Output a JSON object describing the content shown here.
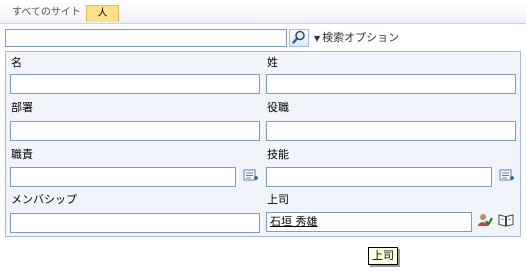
{
  "tabs": [
    {
      "label": "すべてのサイト",
      "active": false
    },
    {
      "label": "人",
      "active": true
    }
  ],
  "search": {
    "value": "",
    "go_icon": "magnifier-icon",
    "options_label": "検索オプション"
  },
  "form": {
    "first_name": {
      "label": "名",
      "value": ""
    },
    "last_name": {
      "label": "姓",
      "value": ""
    },
    "department": {
      "label": "部署",
      "value": ""
    },
    "title": {
      "label": "役職",
      "value": ""
    },
    "responsibilities": {
      "label": "職責",
      "value": "",
      "picker_icon": "browse-list-icon"
    },
    "skills": {
      "label": "技能",
      "value": "",
      "picker_icon": "browse-list-icon"
    },
    "memberships": {
      "label": "メンバシップ",
      "value": ""
    },
    "manager": {
      "label": "上司",
      "value": "石垣 秀雄",
      "check_icon": "check-names-icon",
      "browse_icon": "address-book-icon"
    }
  },
  "tooltip": {
    "text": "上司"
  },
  "colors": {
    "panel_bg": "#f1f5fb",
    "panel_border": "#a6bcd8",
    "active_tab": "#ffe08a",
    "tooltip_bg": "#ffffe1"
  }
}
